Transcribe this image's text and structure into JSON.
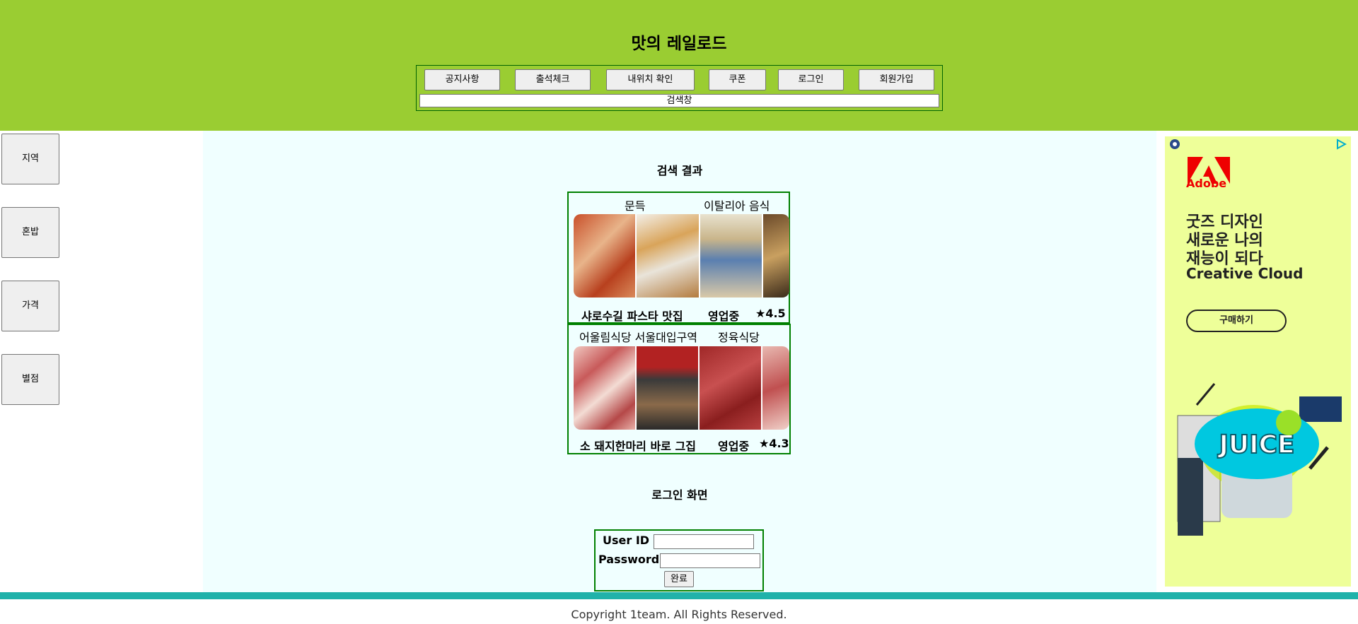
{
  "header": {
    "title": "맛의 레일로드",
    "nav": [
      "공지사항",
      "출석체크",
      "내위치 확인",
      "쿠폰",
      "로그인",
      "회원가입"
    ],
    "search_label": "검색창"
  },
  "sidebar": [
    "지역",
    "혼밥",
    "가격",
    "별점"
  ],
  "main": {
    "results_title": "검색 결과",
    "results": [
      {
        "top_left": "문득",
        "top_right": "이탈리아 음식",
        "name": "샤로수길 파스타 맛집",
        "status": "영업중",
        "rating": "★4.5"
      },
      {
        "top_left": "어울림식당 서울대입구역",
        "top_right": "정육식당",
        "name": "소 돼지한마리 바로 그집",
        "status": "영업중",
        "rating": "★4.3"
      }
    ],
    "login_title": "로그인 화면",
    "login": {
      "user_label": "User ID :",
      "password_label": "Password :",
      "submit": "완료"
    }
  },
  "ad": {
    "brand": "Adobe",
    "lines": [
      "굿즈 디자인",
      "새로운 나의",
      "재능이 되다",
      "Creative Cloud"
    ],
    "cta": "구매하기",
    "graphic_text": "JUICE",
    "icons": [
      "adchoices-icon",
      "privacy-icon"
    ]
  },
  "footer": {
    "copyright": "Copyright 1team. All Rights Reserved."
  },
  "colors": {
    "header_bg": "#9ACD32",
    "main_bg": "#F0FFFF",
    "border_green": "#008000",
    "footer_bar": "#20B2AA",
    "ad_bg": "#EEFF99"
  }
}
